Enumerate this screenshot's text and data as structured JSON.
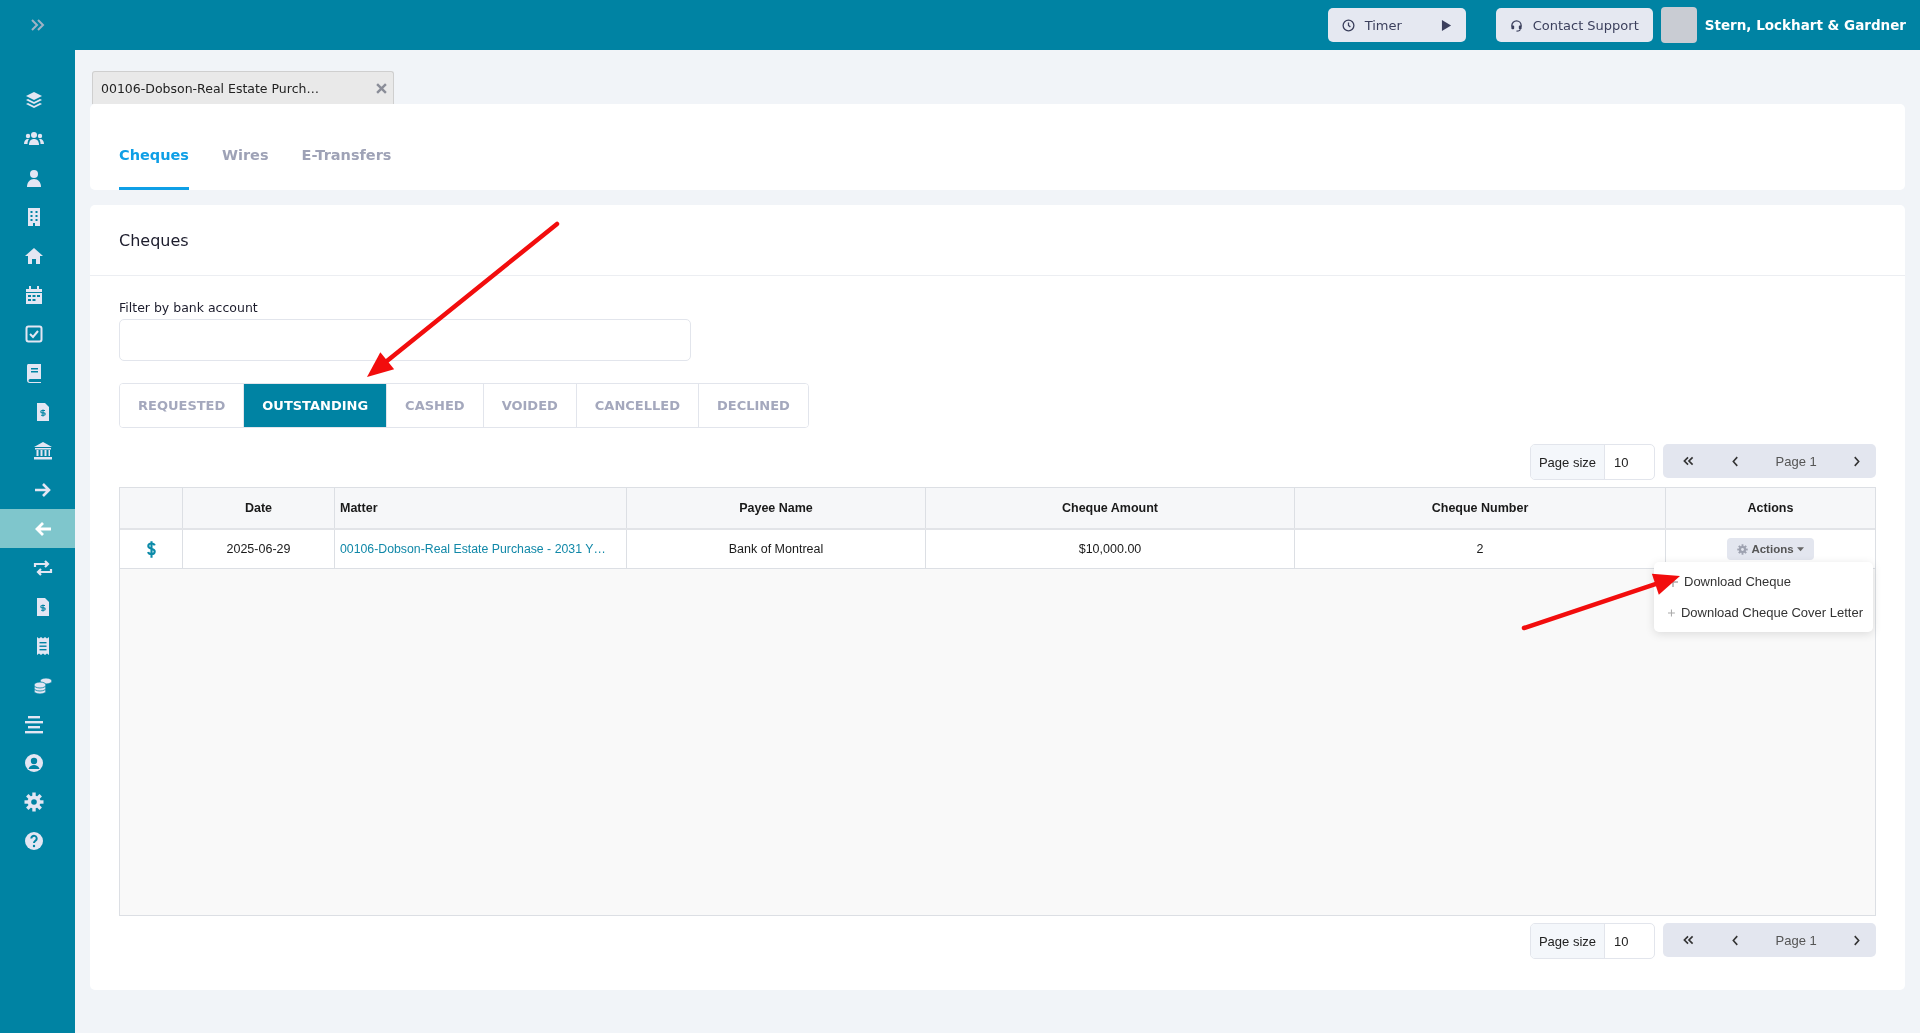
{
  "top_bar": {
    "timer_button": {
      "label": "Timer"
    },
    "support_button": {
      "label": "Contact Support"
    },
    "firm_name": "Stern, Lockhart & Gardner"
  },
  "sidebar": {
    "items": [
      {
        "kind": "layers",
        "selected": false
      },
      {
        "kind": "users",
        "selected": false
      },
      {
        "kind": "user",
        "selected": false
      },
      {
        "kind": "building",
        "selected": false
      },
      {
        "kind": "home",
        "selected": false
      },
      {
        "kind": "calendar",
        "selected": false
      },
      {
        "kind": "checkbox",
        "selected": false
      },
      {
        "kind": "book",
        "selected": false,
        "children": [
          {
            "kind": "invoice",
            "selected": false
          },
          {
            "kind": "bank",
            "selected": false
          },
          {
            "kind": "arrow-right",
            "selected": false
          },
          {
            "kind": "arrow-left",
            "selected": true
          },
          {
            "kind": "repeat",
            "selected": false
          },
          {
            "kind": "invoice",
            "selected": false
          },
          {
            "kind": "receipt",
            "selected": false
          },
          {
            "kind": "coins",
            "selected": false
          }
        ]
      },
      {
        "kind": "align",
        "selected": false
      },
      {
        "kind": "account",
        "selected": false
      },
      {
        "kind": "settings",
        "selected": false
      },
      {
        "kind": "help",
        "selected": false
      }
    ]
  },
  "matter_tab": {
    "label": "00106-Dobson-Real Estate Purch…"
  },
  "tabs": [
    {
      "label": "Cheques",
      "selected": true
    },
    {
      "label": "Wires",
      "selected": false
    },
    {
      "label": "E-Transfers",
      "selected": false
    }
  ],
  "cheques_card": {
    "title": "Cheques",
    "filter": {
      "label": "Filter by bank account"
    },
    "status_tabs": [
      {
        "label": "REQUESTED",
        "selected": false
      },
      {
        "label": "OUTSTANDING",
        "selected": true
      },
      {
        "label": "CASHED",
        "selected": false
      },
      {
        "label": "VOIDED",
        "selected": false
      },
      {
        "label": "CANCELLED",
        "selected": false
      },
      {
        "label": "DECLINED",
        "selected": false
      }
    ],
    "pagination_top": {
      "page_size_label": "Page size",
      "page_size": "10",
      "page": "Page 1"
    },
    "table": {
      "columns": [
        "Date",
        "Matter",
        "Payee Name",
        "Cheque Amount",
        "Cheque Number",
        "Actions"
      ],
      "rows": [
        {
          "date": "2025-06-29",
          "matter": "00106-Dobson-Real Estate Purchase - 2031 Y…",
          "payee": "Bank of Montreal",
          "amount": "$10,000.00",
          "number": "2",
          "action": "Actions",
          "menu_open": true
        }
      ]
    },
    "actions_menu": [
      {
        "label": "Download Cheque"
      },
      {
        "label": "Download Cheque Cover Letter"
      }
    ],
    "pagination_bottom": {
      "page_size_label": "Page size",
      "page_size": "10",
      "page": "Page 1"
    }
  },
  "annotations": [
    {
      "kind": "arrow"
    },
    {
      "kind": "arrow"
    }
  ]
}
